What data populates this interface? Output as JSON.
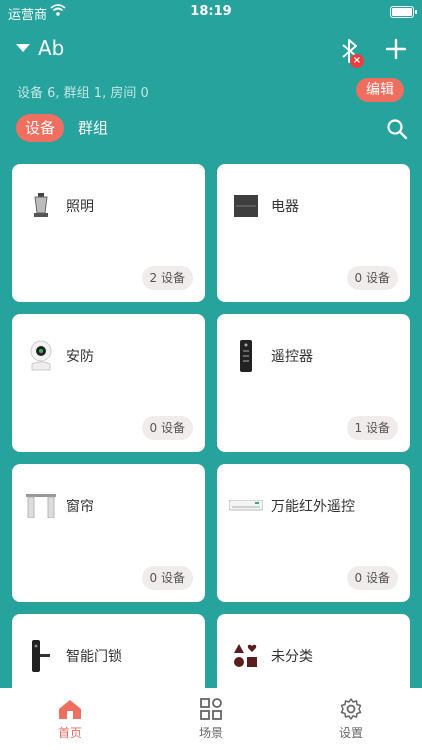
{
  "status": {
    "carrier": "运营商",
    "time": "18:19"
  },
  "header": {
    "home_name": "Ab"
  },
  "summary": {
    "text": "设备 6, 群组 1, 房间 0",
    "edit_label": "编辑"
  },
  "tabs": [
    {
      "label": "设备"
    },
    {
      "label": "群组"
    }
  ],
  "categories": [
    {
      "name": "照明",
      "count": "2 设备",
      "icon": "lamp-icon"
    },
    {
      "name": "电器",
      "count": "0 设备",
      "icon": "appliance-icon"
    },
    {
      "name": "安防",
      "count": "0 设备",
      "icon": "camera-icon"
    },
    {
      "name": "遥控器",
      "count": "1 设备",
      "icon": "remote-icon"
    },
    {
      "name": "窗帘",
      "count": "0 设备",
      "icon": "curtain-icon"
    },
    {
      "name": "万能红外遥控",
      "count": "0 设备",
      "icon": "ac-unit-icon"
    },
    {
      "name": "智能门锁",
      "count": "",
      "icon": "door-lock-icon"
    },
    {
      "name": "未分类",
      "count": "",
      "icon": "shapes-icon"
    }
  ],
  "tabbar": [
    {
      "label": "首页"
    },
    {
      "label": "场景"
    },
    {
      "label": "设置"
    }
  ],
  "colors": {
    "background": "#27a39d",
    "accent": "#ee6e5f",
    "badge": "#e4413e"
  }
}
